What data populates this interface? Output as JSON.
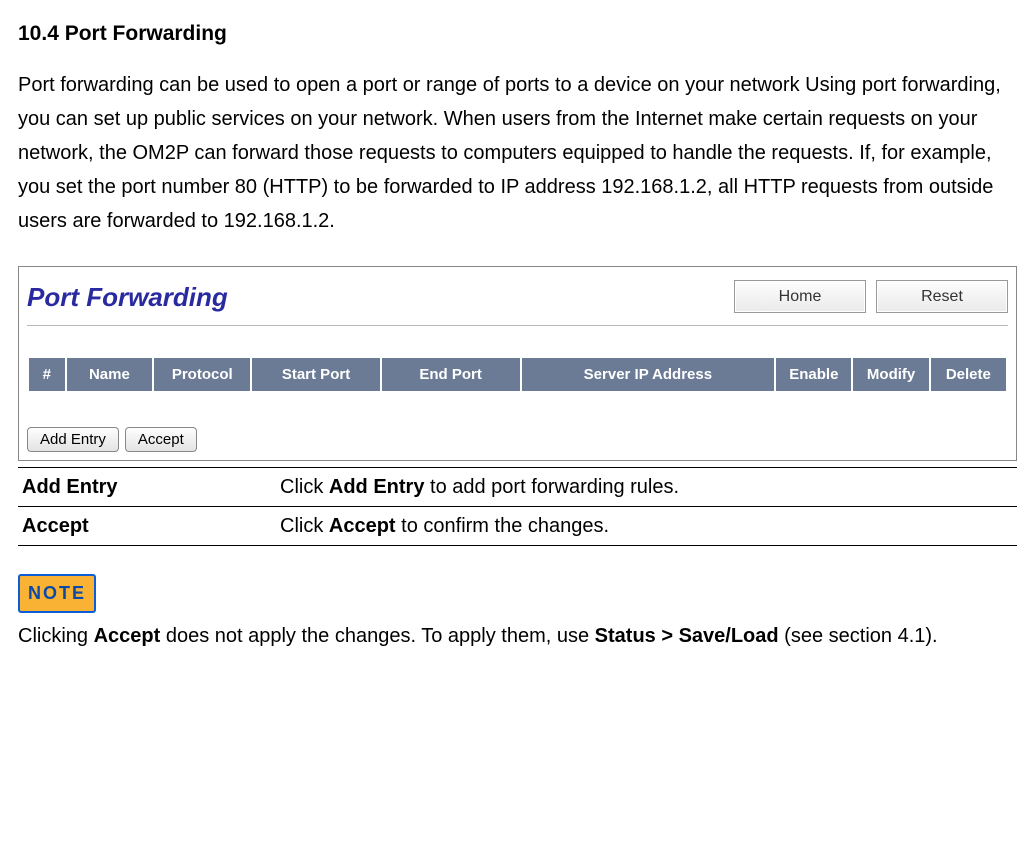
{
  "heading": "10.4 Port Forwarding",
  "intro": "Port forwarding can be used to open a port or range of ports to a device on your network Using port forwarding, you can set up public services on your network. When users from the Internet make certain requests on your network, the OM2P can forward those requests to computers equipped to handle the requests. If, for example, you set the port number 80 (HTTP) to be forwarded to IP address 192.168.1.2, all HTTP requests from outside users are forwarded to 192.168.1.2.",
  "panel": {
    "title": "Port Forwarding",
    "home_btn": "Home",
    "reset_btn": "Reset",
    "cols": {
      "num": "#",
      "name": "Name",
      "protocol": "Protocol",
      "start": "Start Port",
      "end": "End Port",
      "ip": "Server IP Address",
      "enable": "Enable",
      "modify": "Modify",
      "delete": "Delete"
    },
    "add_entry_btn": "Add Entry",
    "accept_btn": "Accept"
  },
  "desc": {
    "add_entry": {
      "term": "Add Entry",
      "pre": "Click ",
      "strong": "Add Entry",
      "post": " to add port forwarding rules."
    },
    "accept": {
      "term": "Accept",
      "pre": "Click ",
      "strong": "Accept",
      "post": " to confirm the changes."
    }
  },
  "note_label": "NOTE",
  "note": {
    "pre": " Clicking ",
    "strong1": "Accept",
    "mid": " does not apply the changes. To apply them, use ",
    "strong2": "Status > Save/Load",
    "post": " (see section 4.1)."
  }
}
